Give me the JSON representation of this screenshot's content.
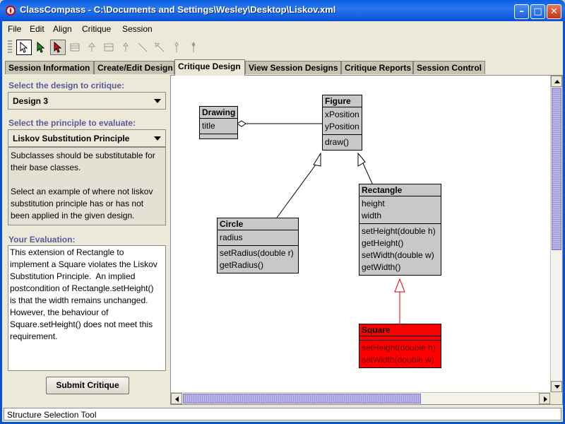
{
  "window": {
    "title": "ClassCompass - C:\\Documents and Settings\\Wesley\\Desktop\\Liskov.xml",
    "minimize": "–",
    "maximize": "□",
    "close": "✕"
  },
  "menu": [
    "File",
    "Edit",
    "Align",
    "Critique",
    "Session"
  ],
  "toolbar": {
    "tools": [
      "pointer-icon",
      "green-pointer-icon",
      "red-pointer-icon",
      "class-icon",
      "inheritance-icon",
      "interface-icon",
      "association-icon",
      "dependency-icon",
      "aggregation-icon",
      "composition-icon"
    ]
  },
  "tabs": [
    "Session Information",
    "Create/Edit Design",
    "Critique Design",
    "View Session Designs",
    "Critique Reports",
    "Session Control"
  ],
  "active_tab": "Critique Design",
  "left_panel": {
    "design_label": "Select the design to critique:",
    "design_value": "Design 3",
    "principle_label": "Select the principle to evaluate:",
    "principle_value": "Liskov Substitution Principle",
    "description": "Subclasses should be substitutable for\ntheir base classes.\n\nSelect an example of where not liskov\nsubstitution principle has or has not\nbeen applied in the given design.",
    "evaluation_label": "Your Evaluation:",
    "evaluation_text": "This extension of Rectangle to\nimplement a Square violates the Liskov\nSubstitution Principle.  An implied\npostcondition of Rectangle.setHeight()\nis that the width remains unchanged.\nHowever, the behaviour of\nSquare.setHeight() does not meet this\nrequirement.",
    "submit_label": "Submit Critique"
  },
  "diagram": {
    "classes": {
      "drawing": {
        "name": "Drawing",
        "attributes": [
          "title"
        ],
        "methods": []
      },
      "figure": {
        "name": "Figure",
        "attributes": [
          "xPosition",
          "yPosition"
        ],
        "methods": [
          "draw()"
        ]
      },
      "circle": {
        "name": "Circle",
        "attributes": [
          "radius"
        ],
        "methods": [
          "setRadius(double r)",
          "getRadius()"
        ]
      },
      "rectangle": {
        "name": "Rectangle",
        "attributes": [
          "height",
          "width"
        ],
        "methods": [
          "setHeight(double h)",
          "getHeight()",
          "setWidth(double w)",
          "getWidth()"
        ]
      },
      "square": {
        "name": "Square",
        "attributes": [],
        "methods": [
          "setHeight(double h)",
          "setWidth(double w)"
        ]
      }
    },
    "highlight_color": "#ff0000"
  },
  "status": "Structure Selection Tool"
}
